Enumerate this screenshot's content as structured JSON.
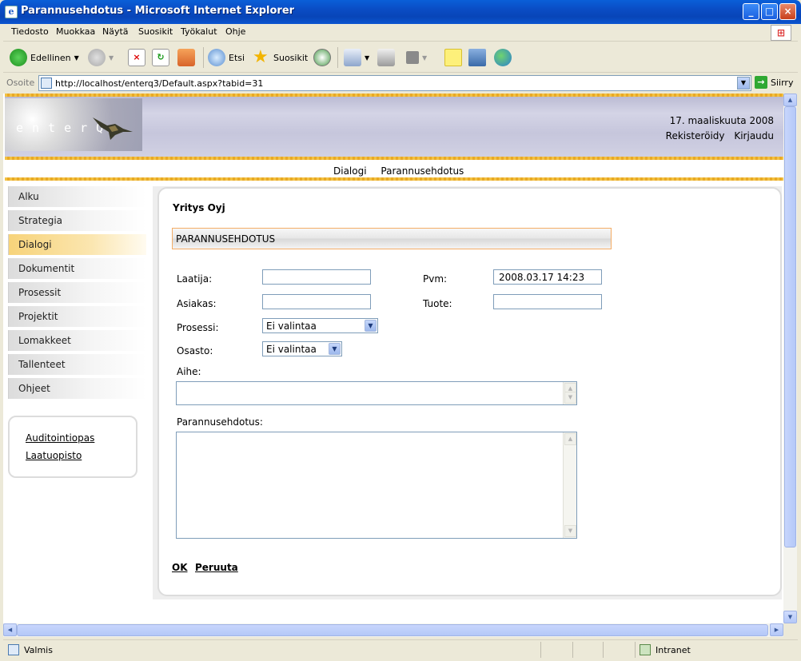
{
  "window": {
    "title": "Parannusehdotus - Microsoft Internet Explorer"
  },
  "menu": [
    "Tiedosto",
    "Muokkaa",
    "Näytä",
    "Suosikit",
    "Työkalut",
    "Ohje"
  ],
  "toolbar": {
    "back_label": "Edellinen",
    "search_label": "Etsi",
    "favorites_label": "Suosikit"
  },
  "address": {
    "label": "Osoite",
    "url": "http://localhost/enterq3/Default.aspx?tabid=31",
    "go_label": "Siirry"
  },
  "site": {
    "logo_text": "enterQ",
    "date": "17. maaliskuuta 2008",
    "register_link": "Rekisteröidy",
    "login_link": "Kirjaudu",
    "breadcrumb": [
      "Dialogi",
      "Parannusehdotus"
    ]
  },
  "sidebar": {
    "items": [
      {
        "label": "Alku",
        "active": false
      },
      {
        "label": "Strategia",
        "active": false
      },
      {
        "label": "Dialogi",
        "active": true
      },
      {
        "label": "Dokumentit",
        "active": false
      },
      {
        "label": "Prosessit",
        "active": false
      },
      {
        "label": "Projektit",
        "active": false
      },
      {
        "label": "Lomakkeet",
        "active": false
      },
      {
        "label": "Tallenteet",
        "active": false
      },
      {
        "label": "Ohjeet",
        "active": false
      }
    ],
    "links": [
      "Auditointiopas",
      "Laatuopisto"
    ]
  },
  "form": {
    "company": "Yritys Oyj",
    "section_title": "PARANNUSEHDOTUS",
    "author_label": "Laatija:",
    "author_value": "",
    "date_label": "Pvm:",
    "date_value": "2008.03.17 14:23",
    "customer_label": "Asiakas:",
    "customer_value": "",
    "product_label": "Tuote:",
    "product_value": "",
    "process_label": "Prosessi:",
    "process_value": "Ei valintaa",
    "department_label": "Osasto:",
    "department_value": "Ei valintaa",
    "subject_label": "Aihe:",
    "suggestion_label": "Parannusehdotus:",
    "ok_label": "OK",
    "cancel_label": "Peruuta"
  },
  "status": {
    "left": "Valmis",
    "zone": "Intranet"
  },
  "colors": {
    "accent_gold": "#f2c244",
    "active_nav": "#f7d37a",
    "section_border": "#f4ad66",
    "title_bar": "#0a4cc4"
  }
}
